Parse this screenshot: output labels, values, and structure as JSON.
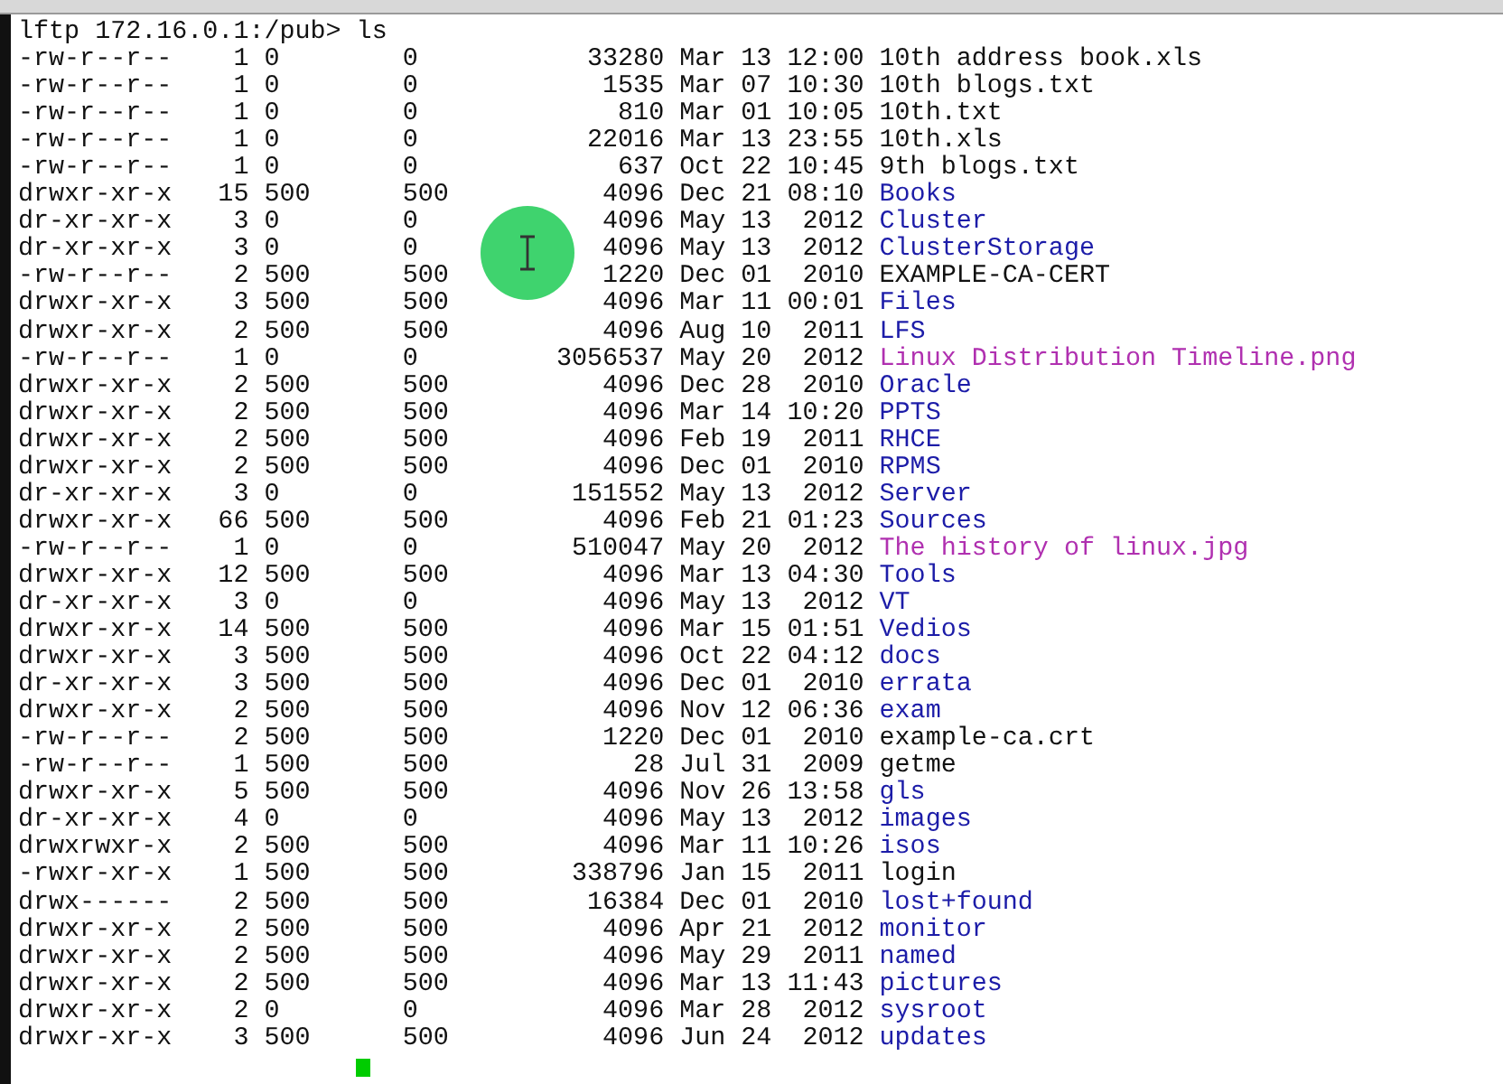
{
  "terminal": {
    "prompt": "lftp 172.16.0.1:/pub> ls",
    "entries": [
      {
        "perms": "-rw-r--r--",
        "links": "1",
        "owner": "0",
        "group": "0",
        "size": "33280",
        "date": "Mar 13 12:00",
        "name": "10th address book.xls",
        "kind": "file"
      },
      {
        "perms": "-rw-r--r--",
        "links": "1",
        "owner": "0",
        "group": "0",
        "size": "1535",
        "date": "Mar 07 10:30",
        "name": "10th blogs.txt",
        "kind": "file"
      },
      {
        "perms": "-rw-r--r--",
        "links": "1",
        "owner": "0",
        "group": "0",
        "size": "810",
        "date": "Mar 01 10:05",
        "name": "10th.txt",
        "kind": "file"
      },
      {
        "perms": "-rw-r--r--",
        "links": "1",
        "owner": "0",
        "group": "0",
        "size": "22016",
        "date": "Mar 13 23:55",
        "name": "10th.xls",
        "kind": "file"
      },
      {
        "perms": "-rw-r--r--",
        "links": "1",
        "owner": "0",
        "group": "0",
        "size": "637",
        "date": "Oct 22 10:45",
        "name": "9th blogs.txt",
        "kind": "file"
      },
      {
        "perms": "drwxr-xr-x",
        "links": "15",
        "owner": "500",
        "group": "500",
        "size": "4096",
        "date": "Dec 21 08:10",
        "name": "Books",
        "kind": "dir"
      },
      {
        "perms": "dr-xr-xr-x",
        "links": "3",
        "owner": "0",
        "group": "0",
        "size": "4096",
        "date": "May 13  2012",
        "name": "Cluster",
        "kind": "dir"
      },
      {
        "perms": "dr-xr-xr-x",
        "links": "3",
        "owner": "0",
        "group": "0",
        "size": "4096",
        "date": "May 13  2012",
        "name": "ClusterStorage",
        "kind": "dir"
      },
      {
        "perms": "-rw-r--r--",
        "links": "2",
        "owner": "500",
        "group": "500",
        "size": "1220",
        "date": "Dec 01  2010",
        "name": "EXAMPLE-CA-CERT",
        "kind": "file"
      },
      {
        "perms": "drwxr-xr-x",
        "links": "3",
        "owner": "500",
        "group": "500",
        "size": "4096",
        "date": "Mar 11 00:01",
        "name": "Files",
        "kind": "dir"
      },
      {
        "perms": "drwxr-xr-x",
        "links": "2",
        "owner": "500",
        "group": "500",
        "size": "4096",
        "date": "Aug 10  2011",
        "name": "LFS",
        "kind": "dir"
      },
      {
        "perms": "-rw-r--r--",
        "links": "1",
        "owner": "0",
        "group": "0",
        "size": "3056537",
        "date": "May 20  2012",
        "name": "Linux Distribution Timeline.png",
        "kind": "image"
      },
      {
        "perms": "drwxr-xr-x",
        "links": "2",
        "owner": "500",
        "group": "500",
        "size": "4096",
        "date": "Dec 28  2010",
        "name": "Oracle",
        "kind": "dir"
      },
      {
        "perms": "drwxr-xr-x",
        "links": "2",
        "owner": "500",
        "group": "500",
        "size": "4096",
        "date": "Mar 14 10:20",
        "name": "PPTS",
        "kind": "dir"
      },
      {
        "perms": "drwxr-xr-x",
        "links": "2",
        "owner": "500",
        "group": "500",
        "size": "4096",
        "date": "Feb 19  2011",
        "name": "RHCE",
        "kind": "dir"
      },
      {
        "perms": "drwxr-xr-x",
        "links": "2",
        "owner": "500",
        "group": "500",
        "size": "4096",
        "date": "Dec 01  2010",
        "name": "RPMS",
        "kind": "dir"
      },
      {
        "perms": "dr-xr-xr-x",
        "links": "3",
        "owner": "0",
        "group": "0",
        "size": "151552",
        "date": "May 13  2012",
        "name": "Server",
        "kind": "dir"
      },
      {
        "perms": "drwxr-xr-x",
        "links": "66",
        "owner": "500",
        "group": "500",
        "size": "4096",
        "date": "Feb 21 01:23",
        "name": "Sources",
        "kind": "dir"
      },
      {
        "perms": "-rw-r--r--",
        "links": "1",
        "owner": "0",
        "group": "0",
        "size": "510047",
        "date": "May 20  2012",
        "name": "The history of linux.jpg",
        "kind": "image"
      },
      {
        "perms": "drwxr-xr-x",
        "links": "12",
        "owner": "500",
        "group": "500",
        "size": "4096",
        "date": "Mar 13 04:30",
        "name": "Tools",
        "kind": "dir"
      },
      {
        "perms": "dr-xr-xr-x",
        "links": "3",
        "owner": "0",
        "group": "0",
        "size": "4096",
        "date": "May 13  2012",
        "name": "VT",
        "kind": "dir"
      },
      {
        "perms": "drwxr-xr-x",
        "links": "14",
        "owner": "500",
        "group": "500",
        "size": "4096",
        "date": "Mar 15 01:51",
        "name": "Vedios",
        "kind": "dir"
      },
      {
        "perms": "drwxr-xr-x",
        "links": "3",
        "owner": "500",
        "group": "500",
        "size": "4096",
        "date": "Oct 22 04:12",
        "name": "docs",
        "kind": "dir"
      },
      {
        "perms": "dr-xr-xr-x",
        "links": "3",
        "owner": "500",
        "group": "500",
        "size": "4096",
        "date": "Dec 01  2010",
        "name": "errata",
        "kind": "dir"
      },
      {
        "perms": "drwxr-xr-x",
        "links": "2",
        "owner": "500",
        "group": "500",
        "size": "4096",
        "date": "Nov 12 06:36",
        "name": "exam",
        "kind": "dir"
      },
      {
        "perms": "-rw-r--r--",
        "links": "2",
        "owner": "500",
        "group": "500",
        "size": "1220",
        "date": "Dec 01  2010",
        "name": "example-ca.crt",
        "kind": "file"
      },
      {
        "perms": "-rw-r--r--",
        "links": "1",
        "owner": "500",
        "group": "500",
        "size": "28",
        "date": "Jul 31  2009",
        "name": "getme",
        "kind": "file"
      },
      {
        "perms": "drwxr-xr-x",
        "links": "5",
        "owner": "500",
        "group": "500",
        "size": "4096",
        "date": "Nov 26 13:58",
        "name": "gls",
        "kind": "dir"
      },
      {
        "perms": "dr-xr-xr-x",
        "links": "4",
        "owner": "0",
        "group": "0",
        "size": "4096",
        "date": "May 13  2012",
        "name": "images",
        "kind": "dir"
      },
      {
        "perms": "drwxrwxr-x",
        "links": "2",
        "owner": "500",
        "group": "500",
        "size": "4096",
        "date": "Mar 11 10:26",
        "name": "isos",
        "kind": "dir"
      },
      {
        "perms": "-rwxr-xr-x",
        "links": "1",
        "owner": "500",
        "group": "500",
        "size": "338796",
        "date": "Jan 15  2011",
        "name": "login",
        "kind": "file"
      },
      {
        "perms": "drwx------",
        "links": "2",
        "owner": "500",
        "group": "500",
        "size": "16384",
        "date": "Dec 01  2010",
        "name": "lost+found",
        "kind": "dir"
      },
      {
        "perms": "drwxr-xr-x",
        "links": "2",
        "owner": "500",
        "group": "500",
        "size": "4096",
        "date": "Apr 21  2012",
        "name": "monitor",
        "kind": "dir"
      },
      {
        "perms": "drwxr-xr-x",
        "links": "2",
        "owner": "500",
        "group": "500",
        "size": "4096",
        "date": "May 29  2011",
        "name": "named",
        "kind": "dir"
      },
      {
        "perms": "drwxr-xr-x",
        "links": "2",
        "owner": "500",
        "group": "500",
        "size": "4096",
        "date": "Mar 13 11:43",
        "name": "pictures",
        "kind": "dir"
      },
      {
        "perms": "drwxr-xr-x",
        "links": "2",
        "owner": "0",
        "group": "0",
        "size": "4096",
        "date": "Mar 28  2012",
        "name": "sysroot",
        "kind": "dir"
      },
      {
        "perms": "drwxr-xr-x",
        "links": "3",
        "owner": "500",
        "group": "500",
        "size": "4096",
        "date": "Jun 24  2012",
        "name": "updates",
        "kind": "dir"
      }
    ]
  }
}
